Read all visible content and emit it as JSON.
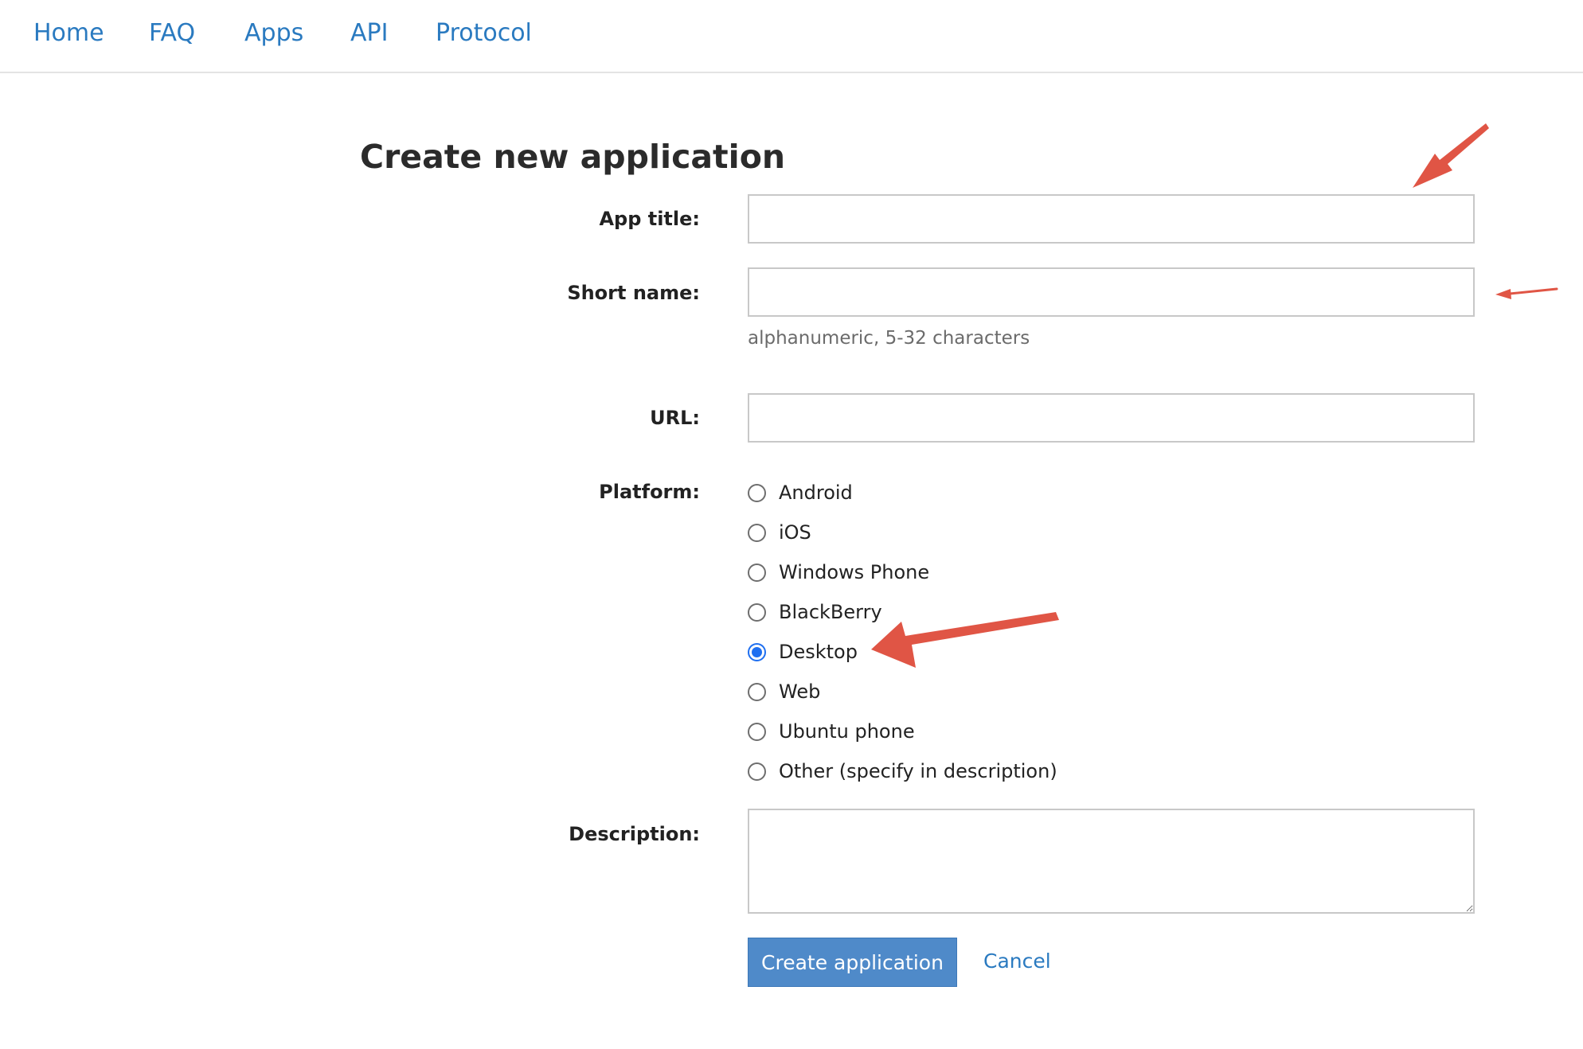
{
  "nav": {
    "items": [
      "Home",
      "FAQ",
      "Apps",
      "API",
      "Protocol"
    ]
  },
  "page_title": "Create new application",
  "form": {
    "app_title_label": "App title:",
    "app_title_value": "",
    "short_name_label": "Short name:",
    "short_name_value": "",
    "short_name_help": "alphanumeric, 5-32 characters",
    "url_label": "URL:",
    "url_value": "",
    "platform_label": "Platform:",
    "platforms": [
      "Android",
      "iOS",
      "Windows Phone",
      "BlackBerry",
      "Desktop",
      "Web",
      "Ubuntu phone",
      "Other (specify in description)"
    ],
    "selected_platform": "Desktop",
    "description_label": "Description:",
    "description_value": "",
    "submit_label": "Create application",
    "cancel_label": "Cancel"
  },
  "colors": {
    "link": "#2a7ac0",
    "button": "#4f8ac9",
    "annotation_arrow": "#e05545",
    "radio_selected": "#1f6ff0"
  },
  "annotations": {
    "icon": "red-arrow-icon",
    "targets": [
      "app-title-input",
      "short-name-input",
      "platform-radio-desktop"
    ]
  }
}
